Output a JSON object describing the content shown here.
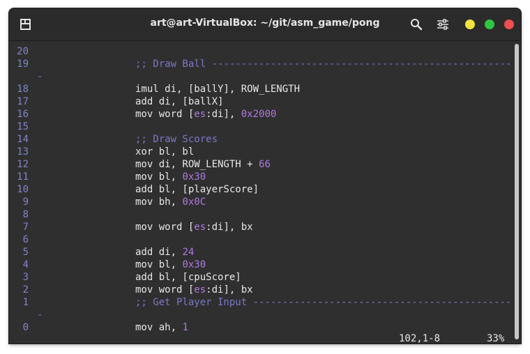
{
  "window": {
    "title": "art@art-VirtualBox: ~/git/asm_game/pong"
  },
  "colors": {
    "close": "#ef4f4f",
    "maximize": "#2fc741",
    "minimize": "#f1e43f",
    "comment": "#7c78c8",
    "number": "#b07ae0",
    "line_number": "#7f86c8"
  },
  "icons": [
    "new-tab-icon",
    "search-icon",
    "menu-sliders-icon"
  ],
  "lines": [
    {
      "n": "20",
      "code": ""
    },
    {
      "n": "19",
      "code": ";; Draw Ball ------------------------------------------------------------"
    },
    {
      "n": "",
      "code": "-"
    },
    {
      "n": "18",
      "code": "imul di, [ballY], ROW_LENGTH"
    },
    {
      "n": "17",
      "code": "add di, [ballX]"
    },
    {
      "n": "16",
      "code": "mov word [es:di], 0x2000"
    },
    {
      "n": "15",
      "code": ""
    },
    {
      "n": "14",
      "code": ";; Draw Scores"
    },
    {
      "n": "13",
      "code": "xor bl, bl"
    },
    {
      "n": "12",
      "code": "mov di, ROW_LENGTH + 66"
    },
    {
      "n": "11",
      "code": "mov bl, 0x30"
    },
    {
      "n": "10",
      "code": "add bl, [playerScore]"
    },
    {
      "n": "9",
      "code": "mov bh, 0x0C"
    },
    {
      "n": "8",
      "code": ""
    },
    {
      "n": "7",
      "code": "mov word [es:di], bx"
    },
    {
      "n": "6",
      "code": ""
    },
    {
      "n": "5",
      "code": "add di, 24"
    },
    {
      "n": "4",
      "code": "mov bl, 0x30"
    },
    {
      "n": "3",
      "code": "add bl, [cpuScore]"
    },
    {
      "n": "2",
      "code": "mov word [es:di], bx"
    },
    {
      "n": "1",
      "code": ";; Get Player Input ----------------------------------------------------"
    },
    {
      "n": "",
      "code": "-"
    },
    {
      "n": "0",
      "code": "mov ah, 1"
    }
  ],
  "status": {
    "position": "102,1-8",
    "percent": "33%"
  }
}
